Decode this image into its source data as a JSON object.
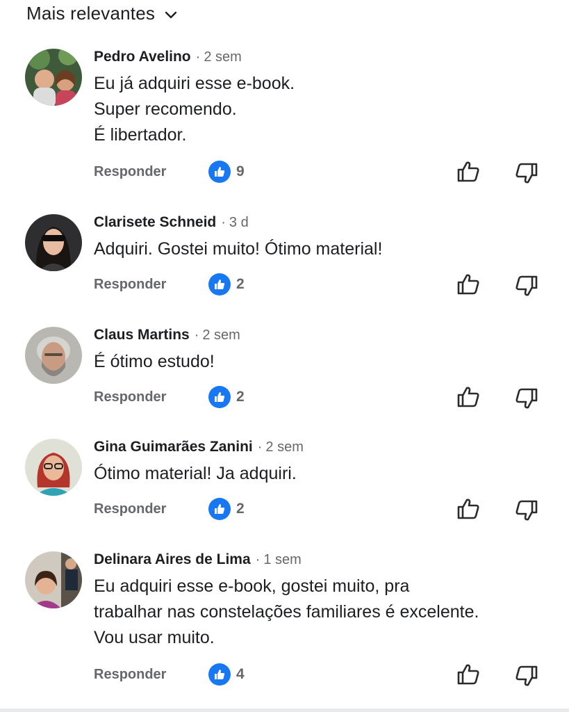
{
  "sort": {
    "label": "Mais relevantes"
  },
  "actions": {
    "reply_label": "Responder",
    "separator": "·"
  },
  "colors": {
    "like_badge": "#1877f2",
    "secondary_text": "#65676b"
  },
  "comments": [
    {
      "author": "Pedro Avelino",
      "time": "2 sem",
      "text": "Eu já adquiri esse e-book.\nSuper recomendo.\nÉ libertador.",
      "likes": "9"
    },
    {
      "author": "Clarisete Schneid",
      "time": "3 d",
      "text": "Adquiri. Gostei muito! Ótimo material!",
      "likes": "2"
    },
    {
      "author": "Claus Martins",
      "time": "2 sem",
      "text": "É ótimo estudo!",
      "likes": "2"
    },
    {
      "author": "Gina Guimarães Zanini",
      "time": "2 sem",
      "text": "Ótimo material! Ja adquiri.",
      "likes": "2"
    },
    {
      "author": "Delinara Aires de Lima",
      "time": "1 sem",
      "text": "Eu adquiri esse e-book, gostei muito, pra\ntrabalhar nas constelações familiares é excelente.\nVou usar muito.",
      "likes": "4"
    }
  ]
}
